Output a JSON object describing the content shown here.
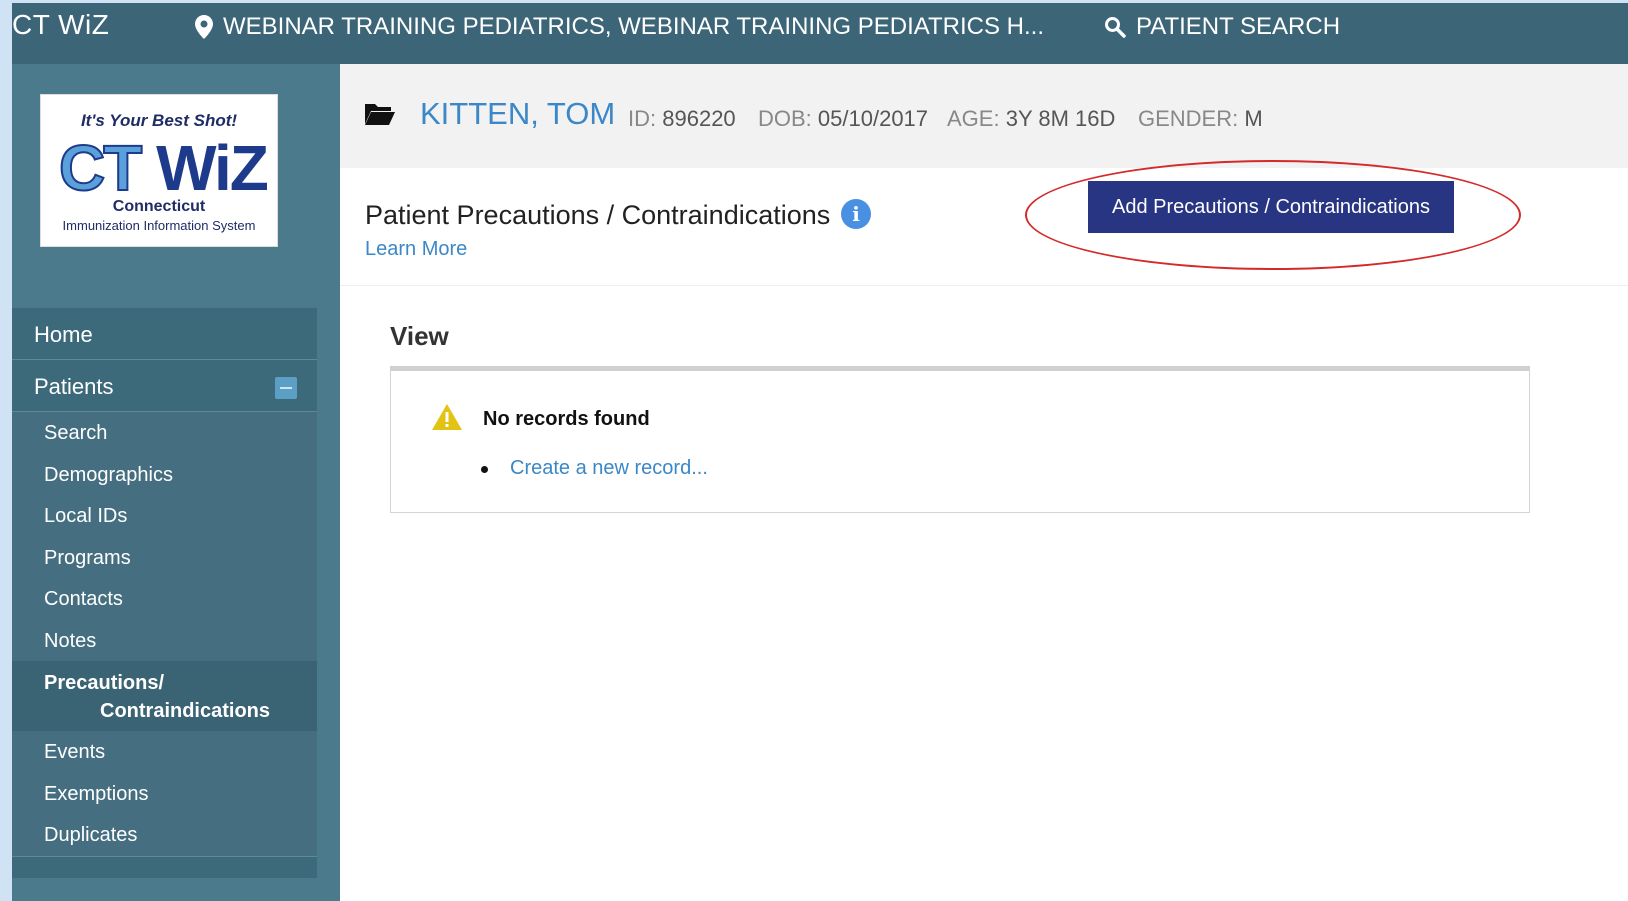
{
  "topbar": {
    "brand": "CT WiZ",
    "location": "WEBINAR TRAINING PEDIATRICS, WEBINAR TRAINING PEDIATRICS H...",
    "patient_search": "PATIENT SEARCH"
  },
  "logo": {
    "tagline": "It's Your Best Shot!",
    "mark_left": "CT",
    "mark_right": "WiZ",
    "line1": "Connecticut",
    "line2": "Immunization Information System"
  },
  "sidebar": {
    "home": "Home",
    "patients": "Patients",
    "sub_items": [
      "Search",
      "Demographics",
      "Local IDs",
      "Programs",
      "Contacts",
      "Notes"
    ],
    "active_line1": "Precautions/",
    "active_line2": "Contraindications",
    "sub_items_after": [
      "Events",
      "Exemptions",
      "Duplicates"
    ]
  },
  "patient": {
    "name": "KITTEN, TOM",
    "id_label": "ID:",
    "id_value": "896220",
    "dob_label": "DOB:",
    "dob_value": "05/10/2017",
    "age_label": "AGE:",
    "age_value": "3Y 8M 16D",
    "gender_label": "GENDER:",
    "gender_value": "M"
  },
  "section": {
    "title": "Patient Precautions / Contraindications",
    "learn_more": "Learn More",
    "add_button": "Add Precautions / Contraindications",
    "view_title": "View",
    "no_records": "No records found",
    "create_link": "Create a new record..."
  },
  "colors": {
    "topbar": "#3c6577",
    "sidebar": "#4a7a8c",
    "link": "#3b87c7",
    "button": "#283583",
    "annotation": "#d42a2a"
  }
}
